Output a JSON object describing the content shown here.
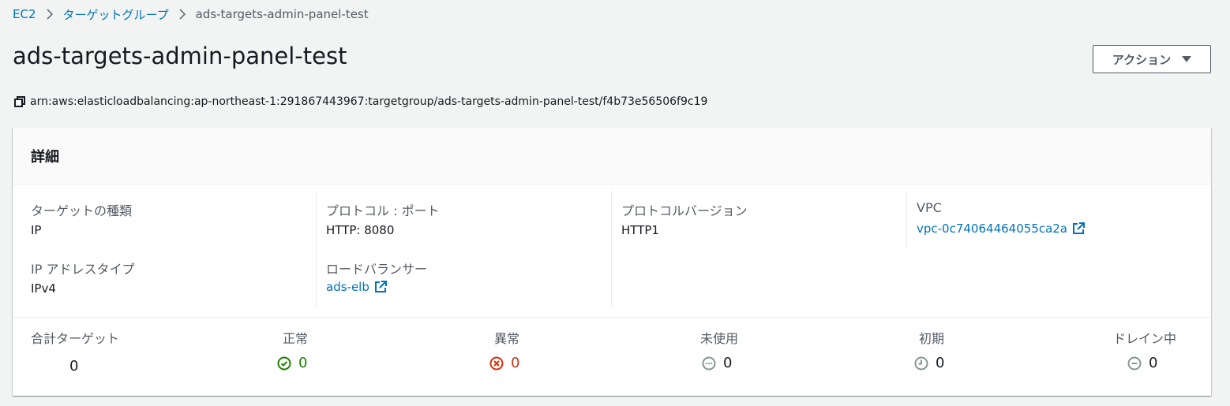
{
  "breadcrumb": {
    "items": [
      "EC2",
      "ターゲットグループ"
    ],
    "current": "ads-targets-admin-panel-test"
  },
  "page": {
    "title": "ads-targets-admin-panel-test",
    "actions_label": "アクション",
    "arn": "arn:aws:elasticloadbalancing:ap-northeast-1:291867443967:targetgroup/ads-targets-admin-panel-test/f4b73e56506f9c19"
  },
  "details": {
    "header": "詳細",
    "target_type_label": "ターゲットの種類",
    "target_type_value": "IP",
    "ip_address_type_label": "IP アドレスタイプ",
    "ip_address_type_value": "IPv4",
    "protocol_port_label": "プロトコル : ポート",
    "protocol_port_value": "HTTP: 8080",
    "load_balancer_label": "ロードバランサー",
    "load_balancer_value": "ads-elb",
    "protocol_version_label": "プロトコルバージョン",
    "protocol_version_value": "HTTP1",
    "vpc_label": "VPC",
    "vpc_value": "vpc-0c74064464055ca2a"
  },
  "stats": {
    "total_label": "合計ターゲット",
    "total_value": "0",
    "healthy_label": "正常",
    "healthy_value": "0",
    "unhealthy_label": "異常",
    "unhealthy_value": "0",
    "unused_label": "未使用",
    "unused_value": "0",
    "initial_label": "初期",
    "initial_value": "0",
    "draining_label": "ドレイン中",
    "draining_value": "0"
  },
  "colors": {
    "link": "#0073bb",
    "healthy": "#1d8102",
    "unhealthy": "#d13212",
    "neutral_icon": "#879596"
  }
}
